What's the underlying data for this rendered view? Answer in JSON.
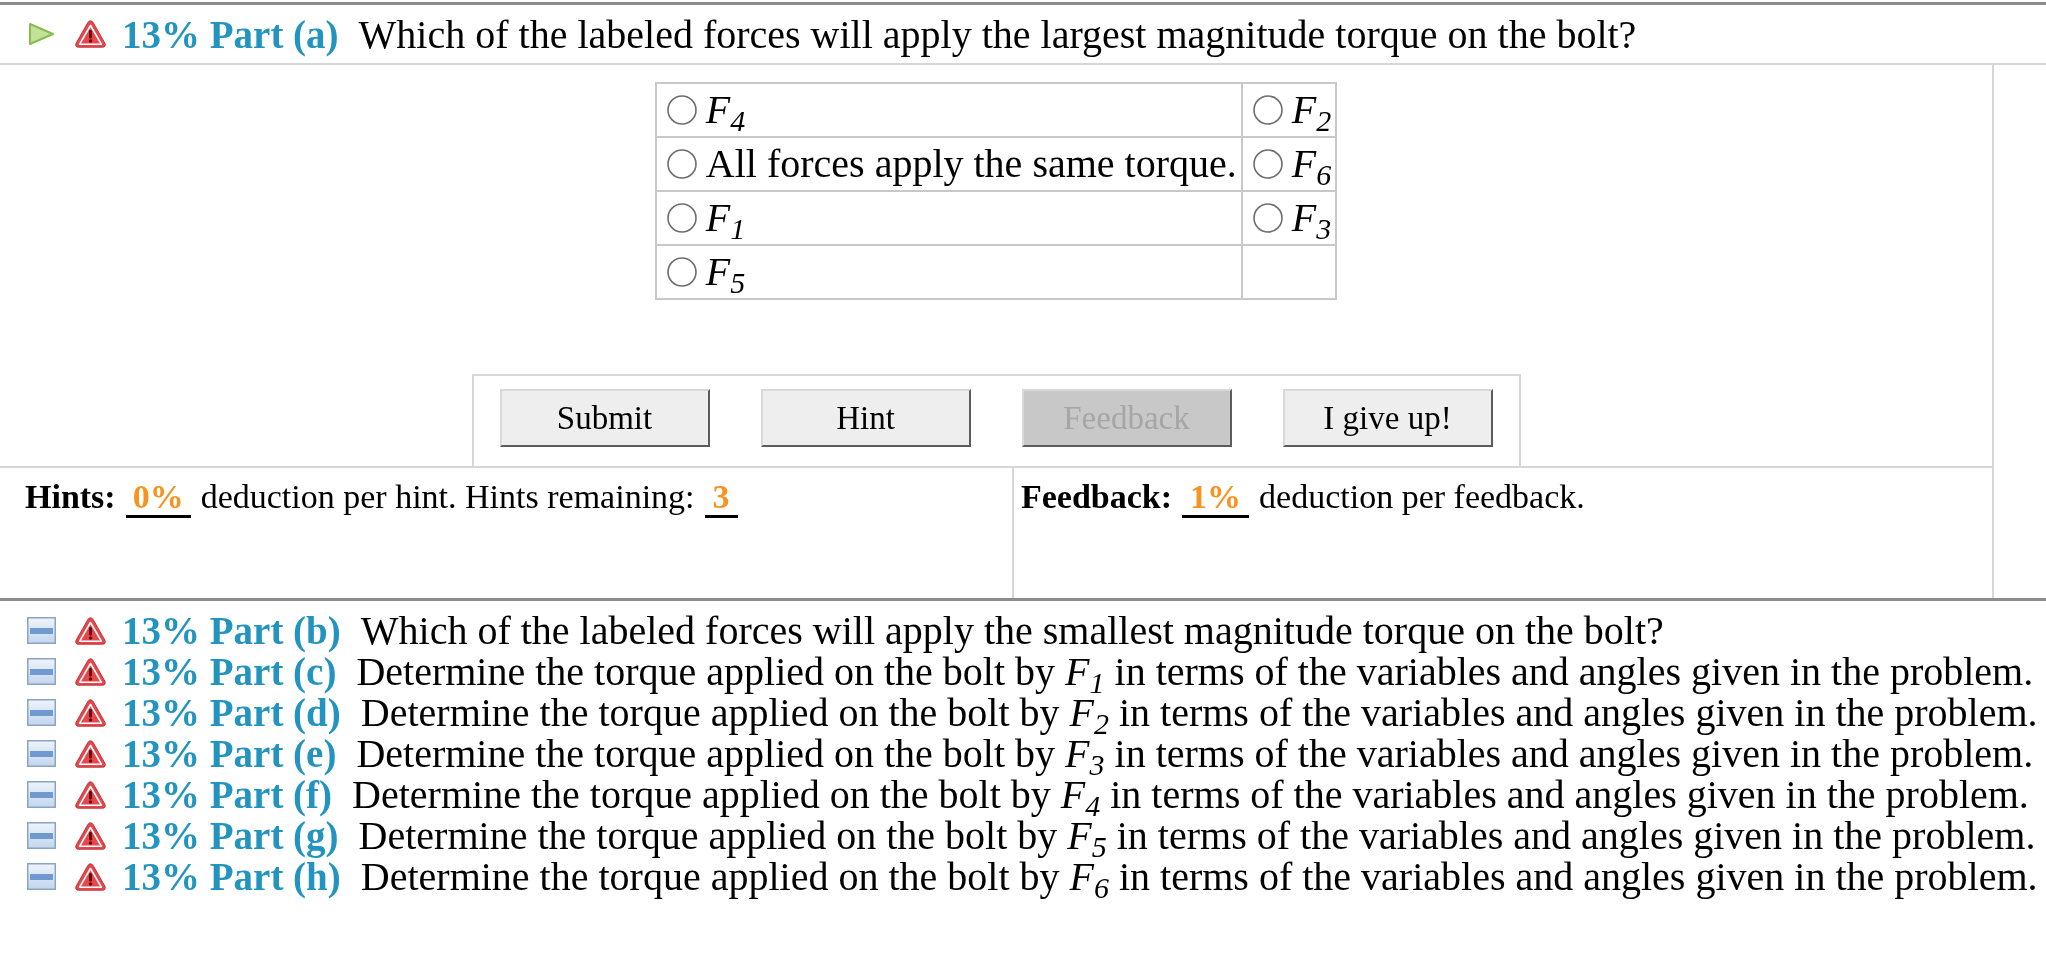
{
  "parts": [
    {
      "title": "13% Part (a)",
      "question": "Which of the labeled forces will apply the largest magnitude torque on the bolt?",
      "expanded": true,
      "options": [
        {
          "label": "*F*$_{4}$",
          "selected": false
        },
        {
          "label": "*F*$_{2}$",
          "selected": false
        },
        {
          "label": "All forces apply the same torque.",
          "selected": false
        },
        {
          "label": "*F*$_{6}$",
          "selected": false
        },
        {
          "label": "*F*$_{1}$",
          "selected": false
        },
        {
          "label": "*F*$_{3}$",
          "selected": false
        },
        {
          "label": "*F*$_{5}$",
          "selected": false
        }
      ],
      "buttons": [
        {
          "label": "Submit",
          "disabled": false
        },
        {
          "label": "Hint",
          "disabled": false
        },
        {
          "label": "Feedback",
          "disabled": true
        },
        {
          "label": "I give up!",
          "disabled": false
        }
      ],
      "hints": {
        "label": "Hints:",
        "deduction": "0%",
        "text": "deduction per hint. Hints remaining:",
        "remaining": "3"
      },
      "feedback": {
        "label": "Feedback:",
        "deduction": "1%",
        "text": "deduction per feedback."
      }
    },
    {
      "title": "13% Part (b)",
      "question": "Which of the labeled forces will apply the smallest magnitude torque on the bolt?",
      "expanded": false
    },
    {
      "title": "13% Part (c)",
      "question": "Determine the torque applied on the bolt by *F*$_{1}$ in terms of the variables and angles given in the problem.",
      "expanded": false
    },
    {
      "title": "13% Part (d)",
      "question": "Determine the torque applied on the bolt by *F*$_{2}$ in terms of the variables and angles given in the problem.",
      "expanded": false
    },
    {
      "title": "13% Part (e)",
      "question": "Determine the torque applied on the bolt by *F*$_{3}$ in terms of the variables and angles given in the problem.",
      "expanded": false
    },
    {
      "title": "13% Part (f)",
      "question": "Determine the torque applied on the bolt by *F*$_{4}$ in terms of the variables and angles given in the problem.",
      "expanded": false
    },
    {
      "title": "13% Part (g)",
      "question": "Determine the torque applied on the bolt by *F*$_{5}$ in terms of the variables and angles given in the problem.",
      "expanded": false
    },
    {
      "title": "13% Part (h)",
      "question": "Determine the torque applied on the bolt by *F*$_{6}$ in terms of the variables and angles given in the problem.",
      "expanded": false
    }
  ]
}
